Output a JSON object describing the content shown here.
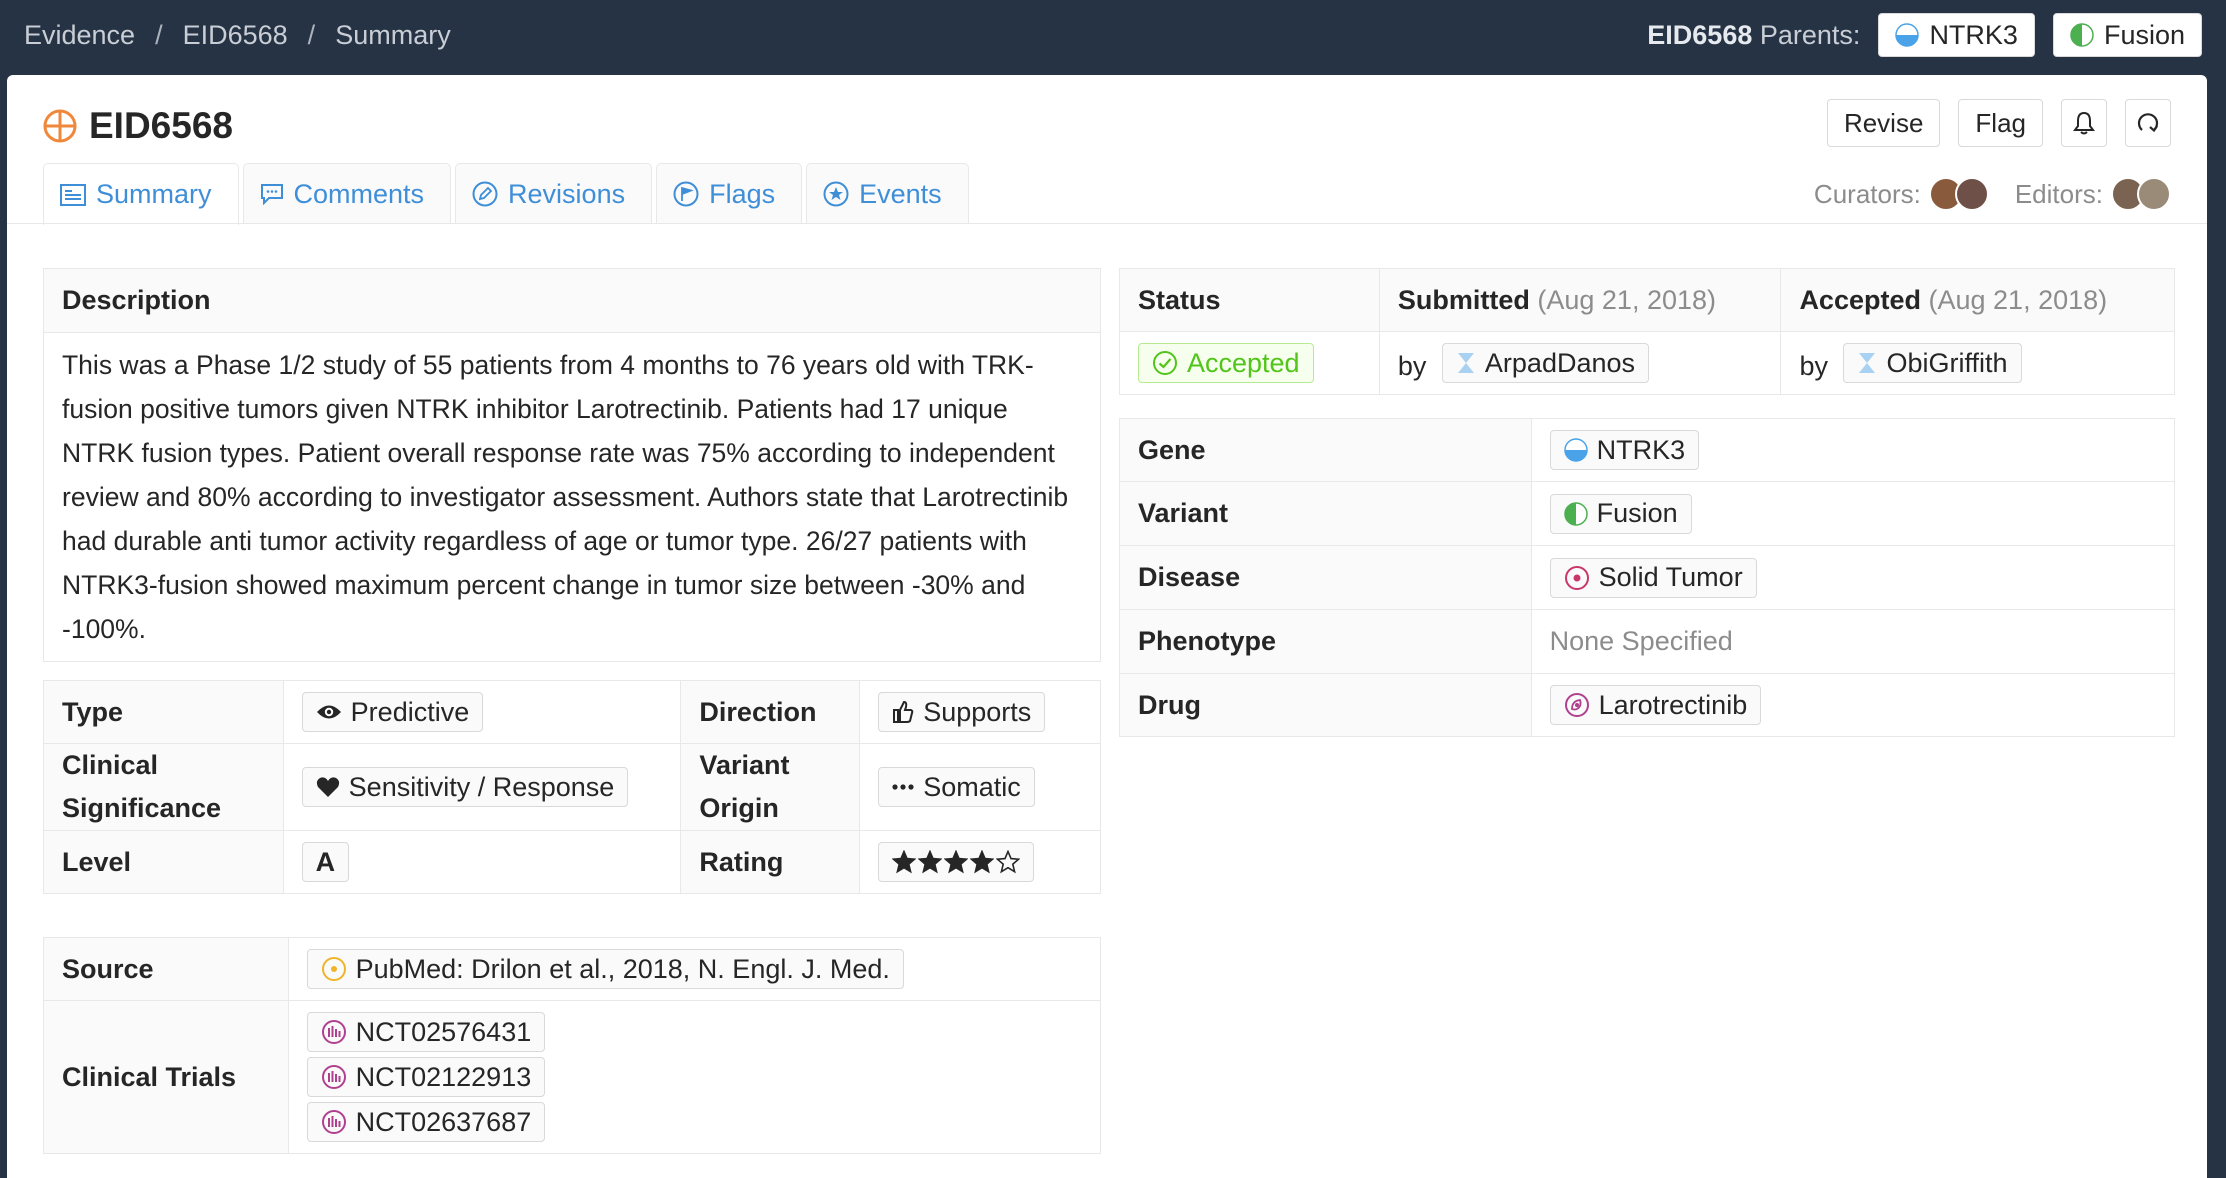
{
  "breadcrumb": {
    "items": [
      "Evidence",
      "EID6568",
      "Summary"
    ],
    "sep": "/"
  },
  "parents": {
    "id": "EID6568",
    "label": "Parents:",
    "gene": "NTRK3",
    "variant": "Fusion"
  },
  "title": "EID6568",
  "actions": {
    "revise": "Revise",
    "flag": "Flag"
  },
  "tabs": [
    "Summary",
    "Comments",
    "Revisions",
    "Flags",
    "Events"
  ],
  "people": {
    "curators": "Curators:",
    "editors": "Editors:"
  },
  "description": {
    "header": "Description",
    "text": "This was a Phase 1/2 study of 55 patients from 4 months to 76 years old with TRK-fusion positive tumors given NTRK inhibitor Larotrectinib. Patients had 17 unique NTRK fusion types. Patient overall response rate was 75% according to independent review and 80% according to investigator assessment. Authors state that Larotrectinib had durable anti tumor activity regardless of age or tumor type. 26/27 patients with NTRK3-fusion showed maximum percent change in tumor size between -30% and -100%."
  },
  "attrs": {
    "type_label": "Type",
    "type_value": "Predictive",
    "direction_label": "Direction",
    "direction_value": "Supports",
    "clinsig_label_1": "Clinical",
    "clinsig_label_2": "Significance",
    "clinsig_value": "Sensitivity / Response",
    "origin_label_1": "Variant",
    "origin_label_2": "Origin",
    "origin_value": "Somatic",
    "level_label": "Level",
    "level_value": "A",
    "rating_label": "Rating",
    "rating_value": 4,
    "rating_max": 5
  },
  "source": {
    "label": "Source",
    "value": "PubMed: Drilon et al., 2018, N. Engl. J. Med.",
    "trials_label": "Clinical Trials",
    "trials": [
      "NCT02576431",
      "NCT02122913",
      "NCT02637687"
    ]
  },
  "status": {
    "status_label": "Status",
    "status_value": "Accepted",
    "submitted_label": "Submitted",
    "submitted_date": "(Aug 21, 2018)",
    "accepted_label": "Accepted",
    "accepted_date": "(Aug 21, 2018)",
    "by": "by",
    "submitter": "ArpadDanos",
    "acceptor": "ObiGriffith"
  },
  "entities": {
    "gene_label": "Gene",
    "gene_value": "NTRK3",
    "variant_label": "Variant",
    "variant_value": "Fusion",
    "disease_label": "Disease",
    "disease_value": "Solid Tumor",
    "phenotype_label": "Phenotype",
    "phenotype_value": "None Specified",
    "drug_label": "Drug",
    "drug_value": "Larotrectinib"
  },
  "colors": {
    "header_bg": "#263344",
    "link": "#3f8fd8",
    "accepted": "#52c41a",
    "evidence_icon": "#f0883c"
  }
}
